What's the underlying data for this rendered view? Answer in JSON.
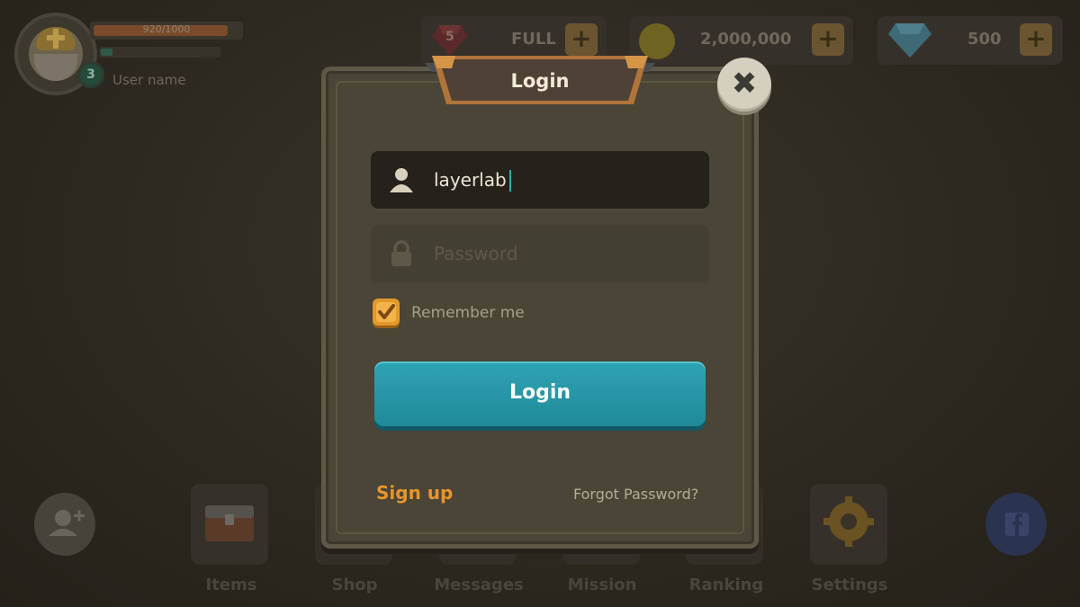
{
  "player": {
    "hp_text": "920/1000",
    "hp_fraction": 0.92,
    "xp_fraction": 0.1,
    "level": "3",
    "username": "User name"
  },
  "resources": {
    "energy": {
      "badge": "5",
      "value": "FULL",
      "plus": "+"
    },
    "gold": {
      "value": "2,000,000",
      "plus": "+"
    },
    "gems": {
      "value": "500",
      "plus": "+"
    }
  },
  "nav": {
    "items": "Items",
    "shop": "Shop",
    "messages": "Messages",
    "mission": "Mission",
    "ranking": "Ranking",
    "settings": "Settings"
  },
  "modal": {
    "title": "Login",
    "close": "✖",
    "username_value": "layerlab",
    "password_placeholder": "Password",
    "remember_label": "Remember me",
    "remember_checked": true,
    "login_button": "Login",
    "signup_link": "Sign up",
    "forgot_link": "Forgot Password?"
  },
  "icons": {
    "user": "user-icon",
    "lock": "lock-icon",
    "check": "check-icon",
    "close": "close-icon",
    "facebook": "facebook-icon"
  },
  "colors": {
    "accent_teal": "#1f8a9a",
    "accent_orange": "#e39a2a",
    "panel": "#4a4536"
  }
}
